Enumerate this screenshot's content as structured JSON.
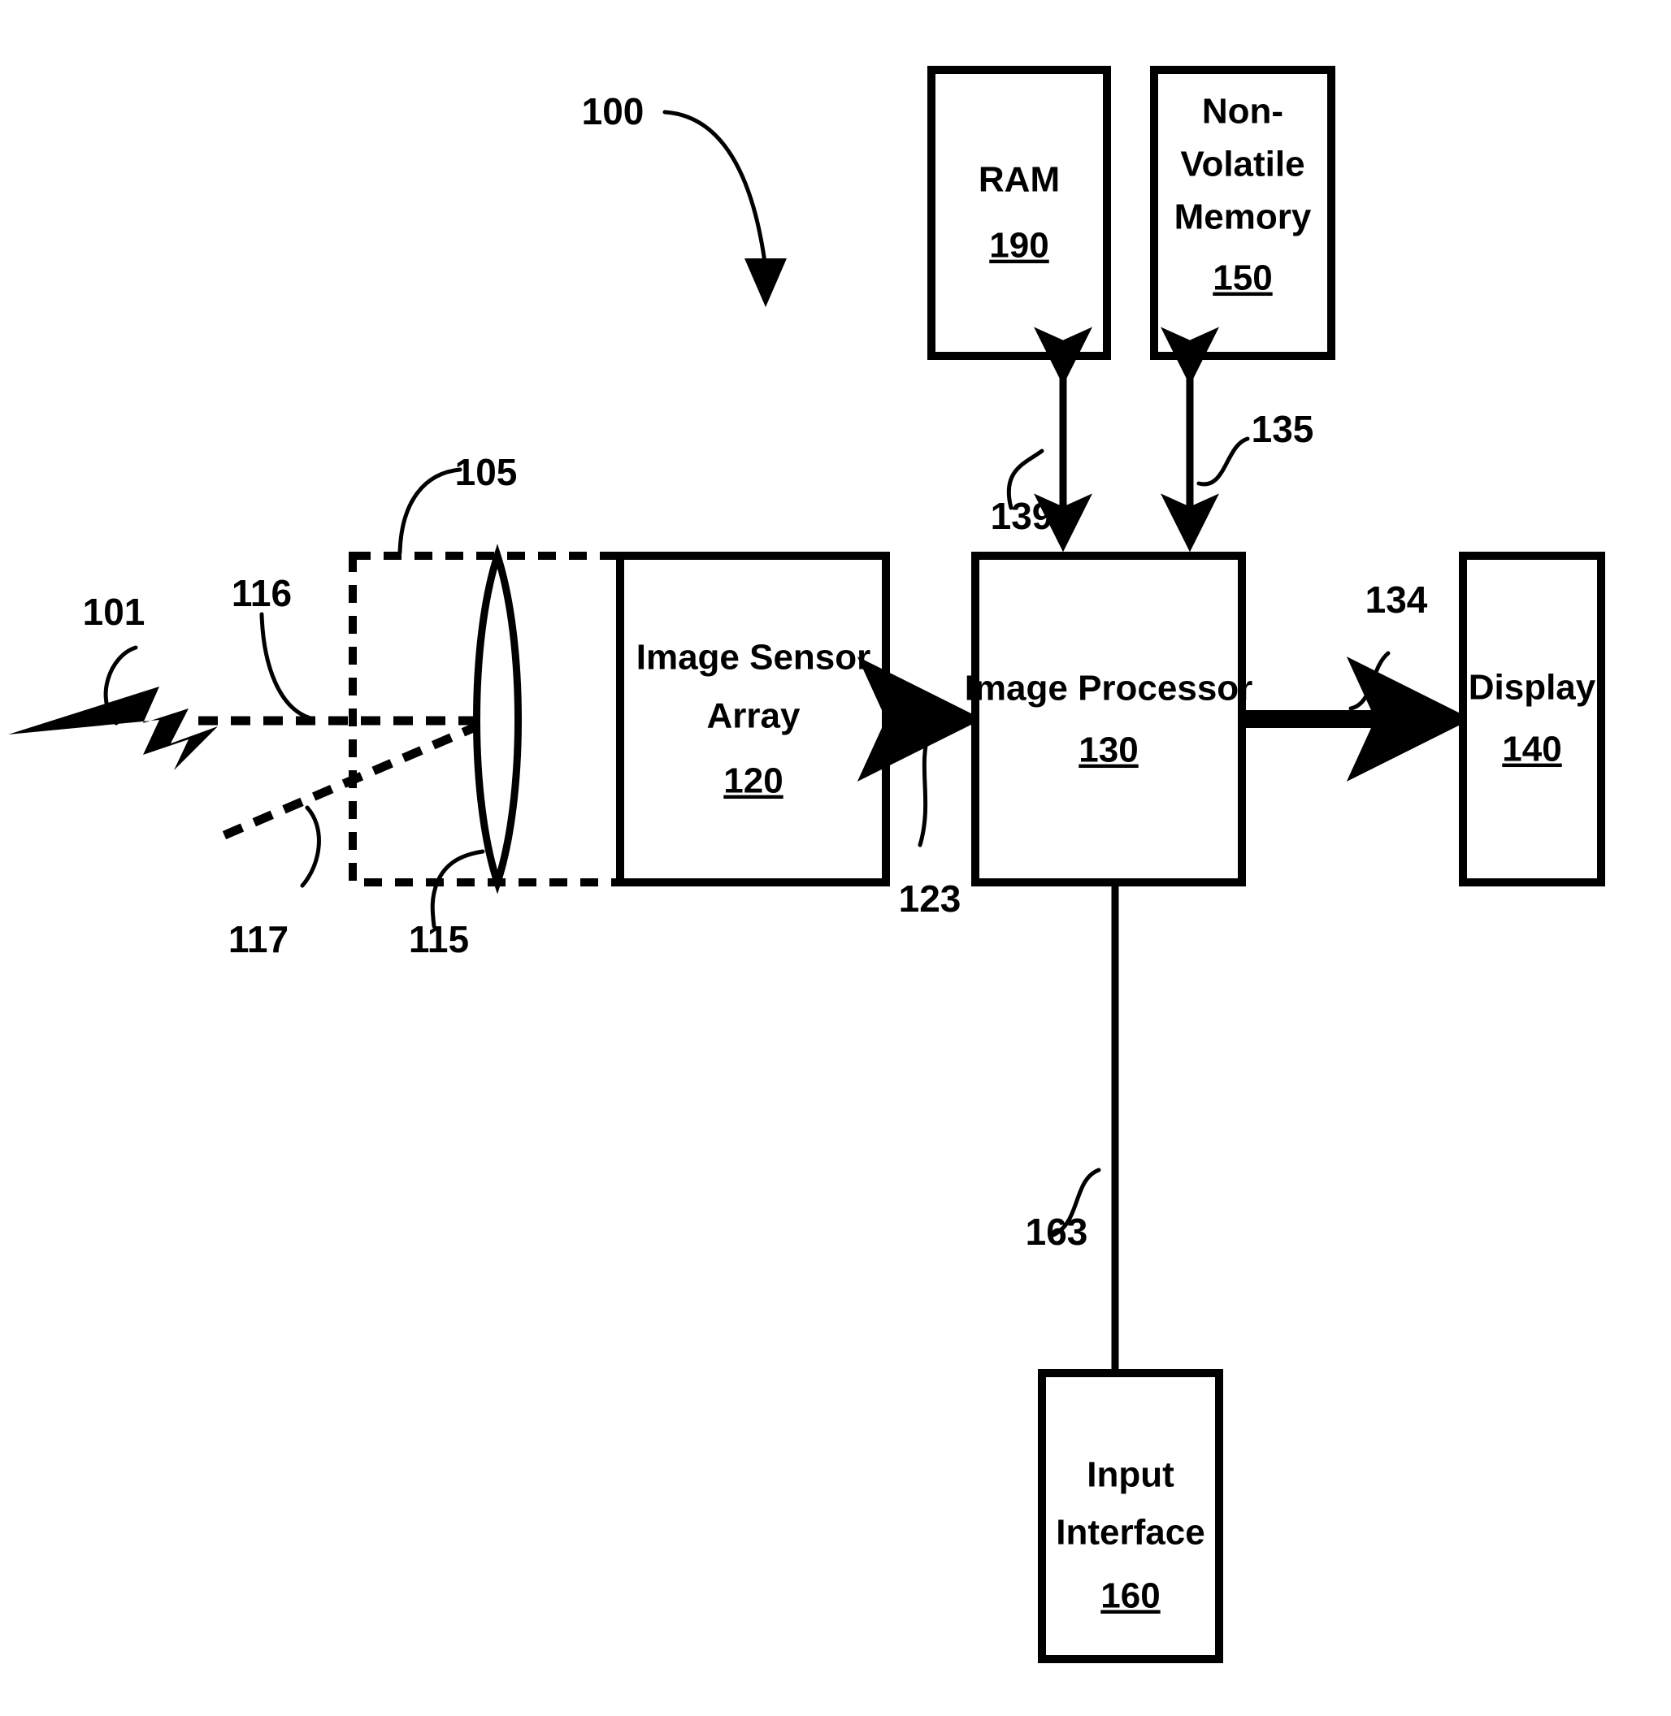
{
  "figure": {
    "figure_ref": "100",
    "incoming_light_ref": "101",
    "optics_assembly_ref": "105",
    "optical_axis_ref": "116",
    "oblique_ray_ref": "117",
    "lens_ref": "115",
    "sensor_to_processor_ref": "123",
    "processor_to_display_ref": "134",
    "processor_to_nvm_ref": "135",
    "processor_to_ram_ref": "139",
    "processor_to_input_ref": "163"
  },
  "blocks": {
    "ram": {
      "title": "RAM",
      "ref": "190"
    },
    "non_volatile_memory": {
      "title_line1": "Non-",
      "title_line2": "Volatile",
      "title_line3": "Memory",
      "ref": "150"
    },
    "image_sensor_array": {
      "title_line1": "Image Sensor",
      "title_line2": "Array",
      "ref": "120"
    },
    "image_processor": {
      "title": "Image Processor",
      "ref": "130"
    },
    "display": {
      "title": "Display",
      "ref": "140"
    },
    "input_interface": {
      "title_line1": "Input",
      "title_line2": "Interface",
      "ref": "160"
    }
  },
  "colors": {
    "ink": "#000000",
    "paper": "#ffffff"
  }
}
